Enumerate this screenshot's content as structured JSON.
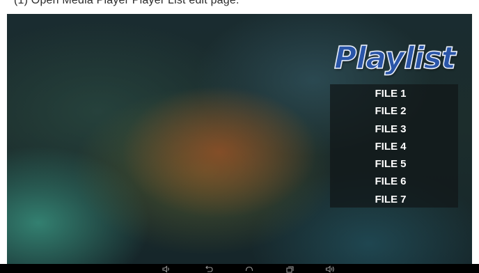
{
  "caption": "(1) Open Media Player Player List edit page.",
  "playlist": {
    "title": "Playlist",
    "items": [
      "FILE 1",
      "FILE 2",
      "FILE 3",
      "FILE 4",
      "FILE 5",
      "FILE 6",
      "FILE 7"
    ]
  },
  "navbar": {
    "buttons": [
      "volume-down-icon",
      "back-icon",
      "home-icon",
      "recent-apps-icon",
      "volume-up-icon"
    ]
  },
  "colors": {
    "title_fill": "#2a55a8",
    "title_outline": "#eef4ff",
    "list_text": "#ffffff",
    "navbar_bg": "#000000"
  }
}
